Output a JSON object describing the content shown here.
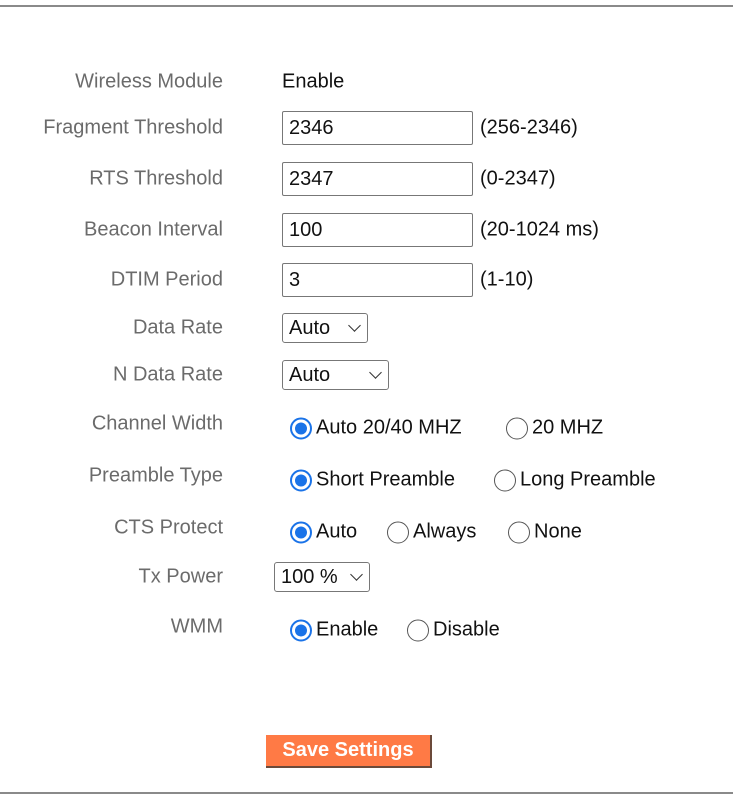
{
  "wireless_module": {
    "label": "Wireless Module",
    "value": "Enable"
  },
  "fragment_threshold": {
    "label": "Fragment Threshold",
    "value": "2346",
    "range": "(256-2346)"
  },
  "rts_threshold": {
    "label": "RTS Threshold",
    "value": "2347",
    "range": "(0-2347)"
  },
  "beacon_interval": {
    "label": "Beacon Interval",
    "value": "100",
    "range": "(20-1024 ms)"
  },
  "dtim_period": {
    "label": "DTIM Period",
    "value": "3",
    "range": "(1-10)"
  },
  "data_rate": {
    "label": "Data Rate",
    "value": "Auto"
  },
  "n_data_rate": {
    "label": "N Data Rate",
    "value": "Auto"
  },
  "channel_width": {
    "label": "Channel Width",
    "options": [
      "Auto 20/40 MHZ",
      "20 MHZ"
    ],
    "selected": "Auto 20/40 MHZ"
  },
  "preamble_type": {
    "label": "Preamble Type",
    "options": [
      "Short Preamble",
      "Long Preamble"
    ],
    "selected": "Short Preamble"
  },
  "cts_protect": {
    "label": "CTS Protect",
    "options": [
      "Auto",
      "Always",
      "None"
    ],
    "selected": "Auto"
  },
  "tx_power": {
    "label": "Tx Power",
    "value": "100 %"
  },
  "wmm": {
    "label": "WMM",
    "options": [
      "Enable",
      "Disable"
    ],
    "selected": "Enable"
  },
  "save_label": "Save Settings",
  "colors": {
    "accent": "#1a73e8",
    "button": "#ff7a45"
  }
}
